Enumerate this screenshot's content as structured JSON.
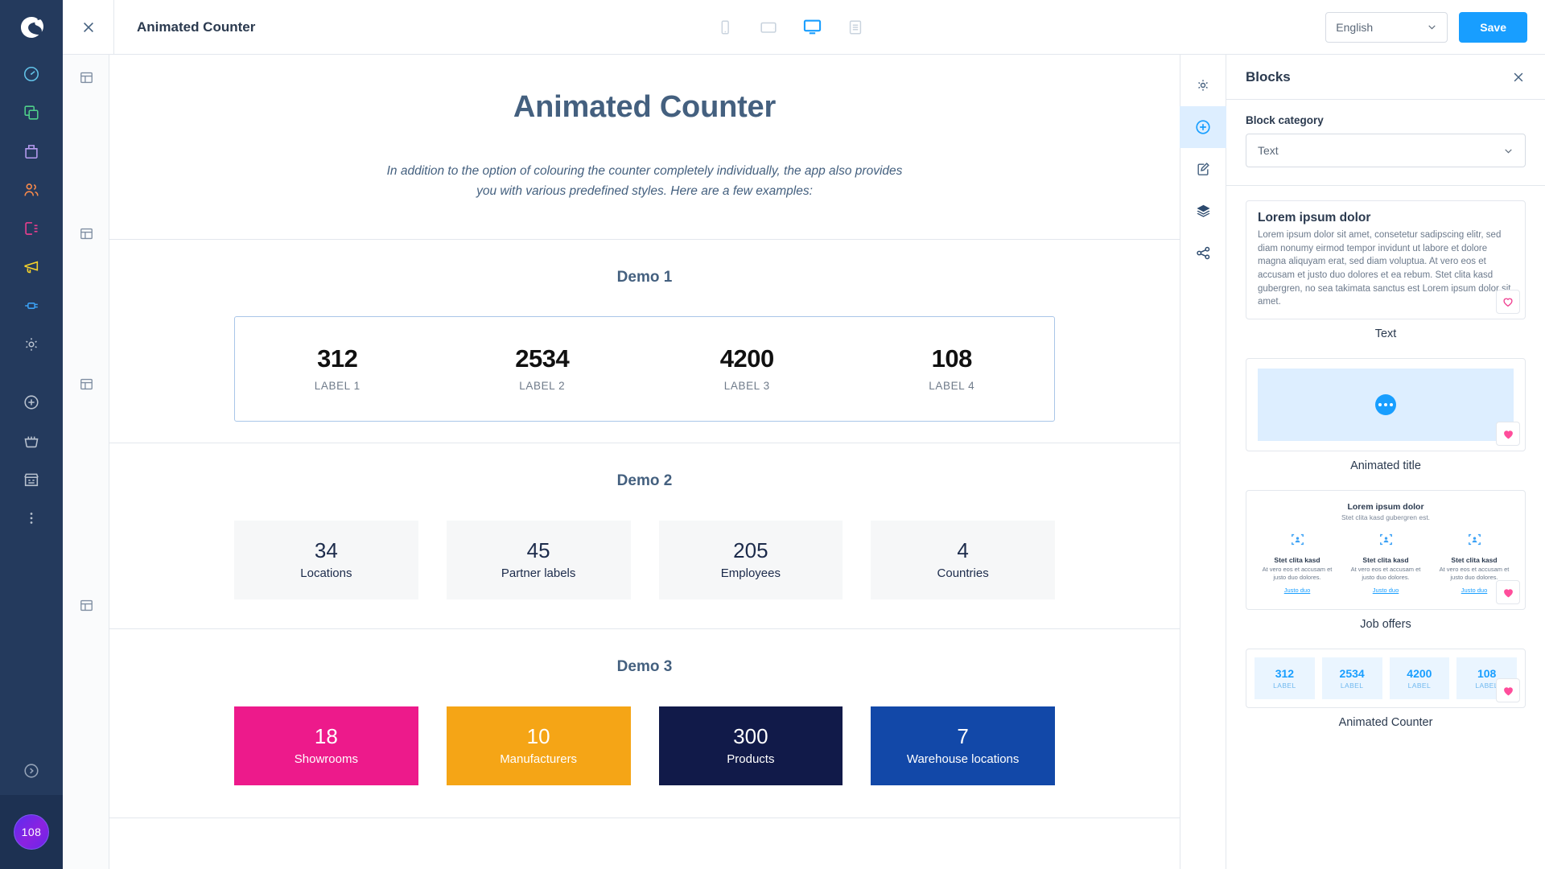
{
  "brand": {
    "accent": "#189eff",
    "rail_bg": "#243a5d"
  },
  "rail": {
    "logo_name": "shopware-logo",
    "items": [
      {
        "name": "dashboard-icon",
        "color": "#62c2e8"
      },
      {
        "name": "catalogue-icon",
        "color": "#4fd08a"
      },
      {
        "name": "orders-icon",
        "color": "#b69bf0"
      },
      {
        "name": "customers-icon",
        "color": "#f88a4b"
      },
      {
        "name": "content-icon",
        "color": "#ef3f90"
      },
      {
        "name": "marketing-icon",
        "color": "#f7d32a"
      },
      {
        "name": "extensions-icon",
        "color": "#3ba1f5"
      },
      {
        "name": "settings-icon",
        "color": "#b9c2cf"
      }
    ],
    "shortcuts": [
      {
        "name": "add-icon",
        "color": "#b9c2cf"
      },
      {
        "name": "basket-icon",
        "color": "#b9c2cf"
      },
      {
        "name": "storefront-icon",
        "color": "#b9c2cf"
      },
      {
        "name": "more-icon",
        "color": "#b9c2cf"
      }
    ],
    "collapse_name": "expand-rail-icon",
    "avatar_initials": "108"
  },
  "topbar": {
    "close_label": "close-icon",
    "title": "Animated Counter",
    "devices": [
      {
        "name": "mobile-view",
        "active": false
      },
      {
        "name": "tablet-view",
        "active": false
      },
      {
        "name": "desktop-view",
        "active": true
      },
      {
        "name": "form-view",
        "active": false
      }
    ],
    "language": "English",
    "save_label": "Save"
  },
  "canvas": {
    "hero": {
      "title": "Animated Counter",
      "subtitle": "In addition to the option of colouring the counter completely individually, the app also provides you with various predefined styles. Here are a few examples:"
    },
    "demo1": {
      "heading": "Demo 1",
      "selected": true,
      "cells": [
        {
          "value": "312",
          "label": "LABEL 1"
        },
        {
          "value": "2534",
          "label": "LABEL 2"
        },
        {
          "value": "4200",
          "label": "LABEL 3"
        },
        {
          "value": "108",
          "label": "LABEL 4"
        }
      ]
    },
    "demo2": {
      "heading": "Demo 2",
      "cells": [
        {
          "value": "34",
          "label": "Locations"
        },
        {
          "value": "45",
          "label": "Partner labels"
        },
        {
          "value": "205",
          "label": "Employees"
        },
        {
          "value": "4",
          "label": "Countries"
        }
      ]
    },
    "demo3": {
      "heading": "Demo 3",
      "cells": [
        {
          "value": "18",
          "label": "Showrooms",
          "bg": "#ed1a8b"
        },
        {
          "value": "10",
          "label": "Manufacturers",
          "bg": "#f5a516"
        },
        {
          "value": "300",
          "label": "Products",
          "bg": "#111a49"
        },
        {
          "value": "7",
          "label": "Warehouse locations",
          "bg": "#1248a8"
        }
      ]
    }
  },
  "panel_rail": {
    "items": [
      {
        "name": "settings-tab-icon",
        "active": false
      },
      {
        "name": "add-blocks-tab-icon",
        "active": true
      },
      {
        "name": "edit-tab-icon",
        "active": false
      },
      {
        "name": "layers-tab-icon",
        "active": false
      },
      {
        "name": "share-tab-icon",
        "active": false
      }
    ]
  },
  "blocks_panel": {
    "title": "Blocks",
    "close_label": "close-icon",
    "category_label": "Block category",
    "category_value": "Text",
    "items": [
      {
        "caption": "Text",
        "favorited": false,
        "preview": {
          "type": "text",
          "heading": "Lorem ipsum dolor",
          "paragraph": "Lorem ipsum dolor sit amet, consetetur sadipscing elitr, sed diam nonumy eirmod tempor invidunt ut labore et dolore magna aliquyam erat, sed diam voluptua. At vero eos et accusam et justo duo dolores et ea rebum. Stet clita kasd gubergren, no sea takimata sanctus est Lorem ipsum dolor sit amet."
        }
      },
      {
        "caption": "Animated title",
        "favorited": true,
        "preview": {
          "type": "animated-title"
        }
      },
      {
        "caption": "Job offers",
        "favorited": true,
        "preview": {
          "type": "job-offers",
          "heading": "Lorem ipsum dolor",
          "subheading": "Stet clita kasd gubergren est.",
          "columns": [
            {
              "title": "Stet clita kasd",
              "text": "At vero eos et accusam et justo duo dolores.",
              "link": "Justo duo"
            },
            {
              "title": "Stet clita kasd",
              "text": "At vero eos et accusam et justo duo dolores.",
              "link": "Justo duo"
            },
            {
              "title": "Stet clita kasd",
              "text": "At vero eos et accusam et justo duo dolores.",
              "link": "Justo duo"
            }
          ]
        }
      },
      {
        "caption": "Animated Counter",
        "favorited": true,
        "preview": {
          "type": "animated-counter",
          "cells": [
            {
              "value": "312",
              "label": "LABEL"
            },
            {
              "value": "2534",
              "label": "LABEL"
            },
            {
              "value": "4200",
              "label": "LABEL"
            },
            {
              "value": "108",
              "label": "LABEL"
            }
          ]
        }
      }
    ]
  }
}
